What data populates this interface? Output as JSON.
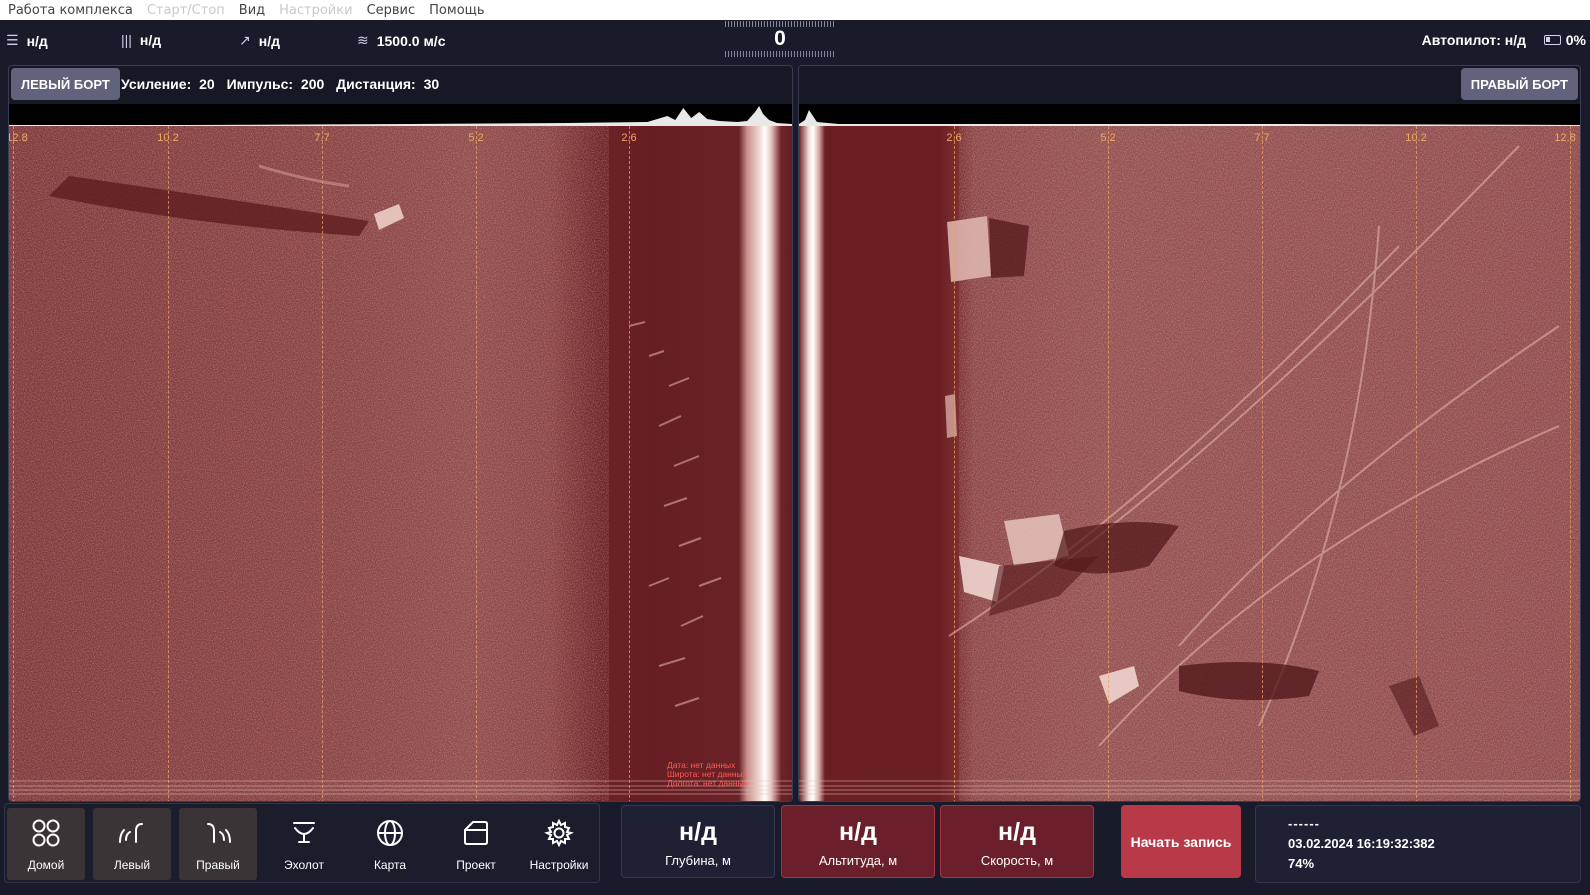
{
  "menu": {
    "items": [
      {
        "label": "Работа комплекса",
        "enabled": true
      },
      {
        "label": "Старт/Стоп",
        "enabled": false
      },
      {
        "label": "Вид",
        "enabled": true
      },
      {
        "label": "Настройки",
        "enabled": false
      },
      {
        "label": "Сервис",
        "enabled": true
      },
      {
        "label": "Помощь",
        "enabled": true
      }
    ]
  },
  "status": {
    "heading": "н/д",
    "pitch": "н/д",
    "direction": "н/д",
    "sound_speed": "1500.0 м/с",
    "counter": "0",
    "autopilot": "Автопилот: н/д",
    "battery": "0%"
  },
  "left_panel": {
    "button": "ЛЕВЫЙ БОРТ",
    "gain_label": "Усиление:",
    "gain_value": "20",
    "impulse_label": "Импульс:",
    "impulse_value": "200",
    "distance_label": "Дистанция:",
    "distance_value": "30",
    "distance_marks": [
      "12.8",
      "10.2",
      "7.7",
      "5.2",
      "2.6"
    ],
    "nav_info": {
      "date": "Дата: нет данных",
      "lat": "Широта: нет данных",
      "lon": "Долгота: нет данных"
    }
  },
  "right_panel": {
    "button": "ПРАВЫЙ БОРТ",
    "distance_marks": [
      "2.6",
      "5.2",
      "7.7",
      "10.2",
      "12.8"
    ]
  },
  "nav": [
    {
      "label": "Домой",
      "icon": "home-grid-icon",
      "active": true
    },
    {
      "label": "Левый",
      "icon": "left-sonar-icon",
      "active": true
    },
    {
      "label": "Правый",
      "icon": "right-sonar-icon",
      "active": true
    },
    {
      "label": "Эхолот",
      "icon": "echosounder-icon",
      "active": false
    },
    {
      "label": "Карта",
      "icon": "globe-icon",
      "active": false
    },
    {
      "label": "Проект",
      "icon": "folder-icon",
      "active": false
    },
    {
      "label": "Настройки",
      "icon": "gear-icon",
      "active": false
    }
  ],
  "metrics": {
    "depth": {
      "value": "н/д",
      "label": "Глубина, м"
    },
    "altitude": {
      "value": "н/д",
      "label": "Альтитуда, м"
    },
    "speed": {
      "value": "н/д",
      "label": "Скорость, м"
    }
  },
  "record_button": "Начать запись",
  "info": {
    "dashes": "------",
    "datetime": "03.02.2024  16:19:32:382",
    "percent": "74%"
  },
  "colors": {
    "sonar_tint": "#8a3a3c",
    "panel_bg": "#171826",
    "accent_red": "#b83a48",
    "alert_red": "#6b1f2b"
  }
}
